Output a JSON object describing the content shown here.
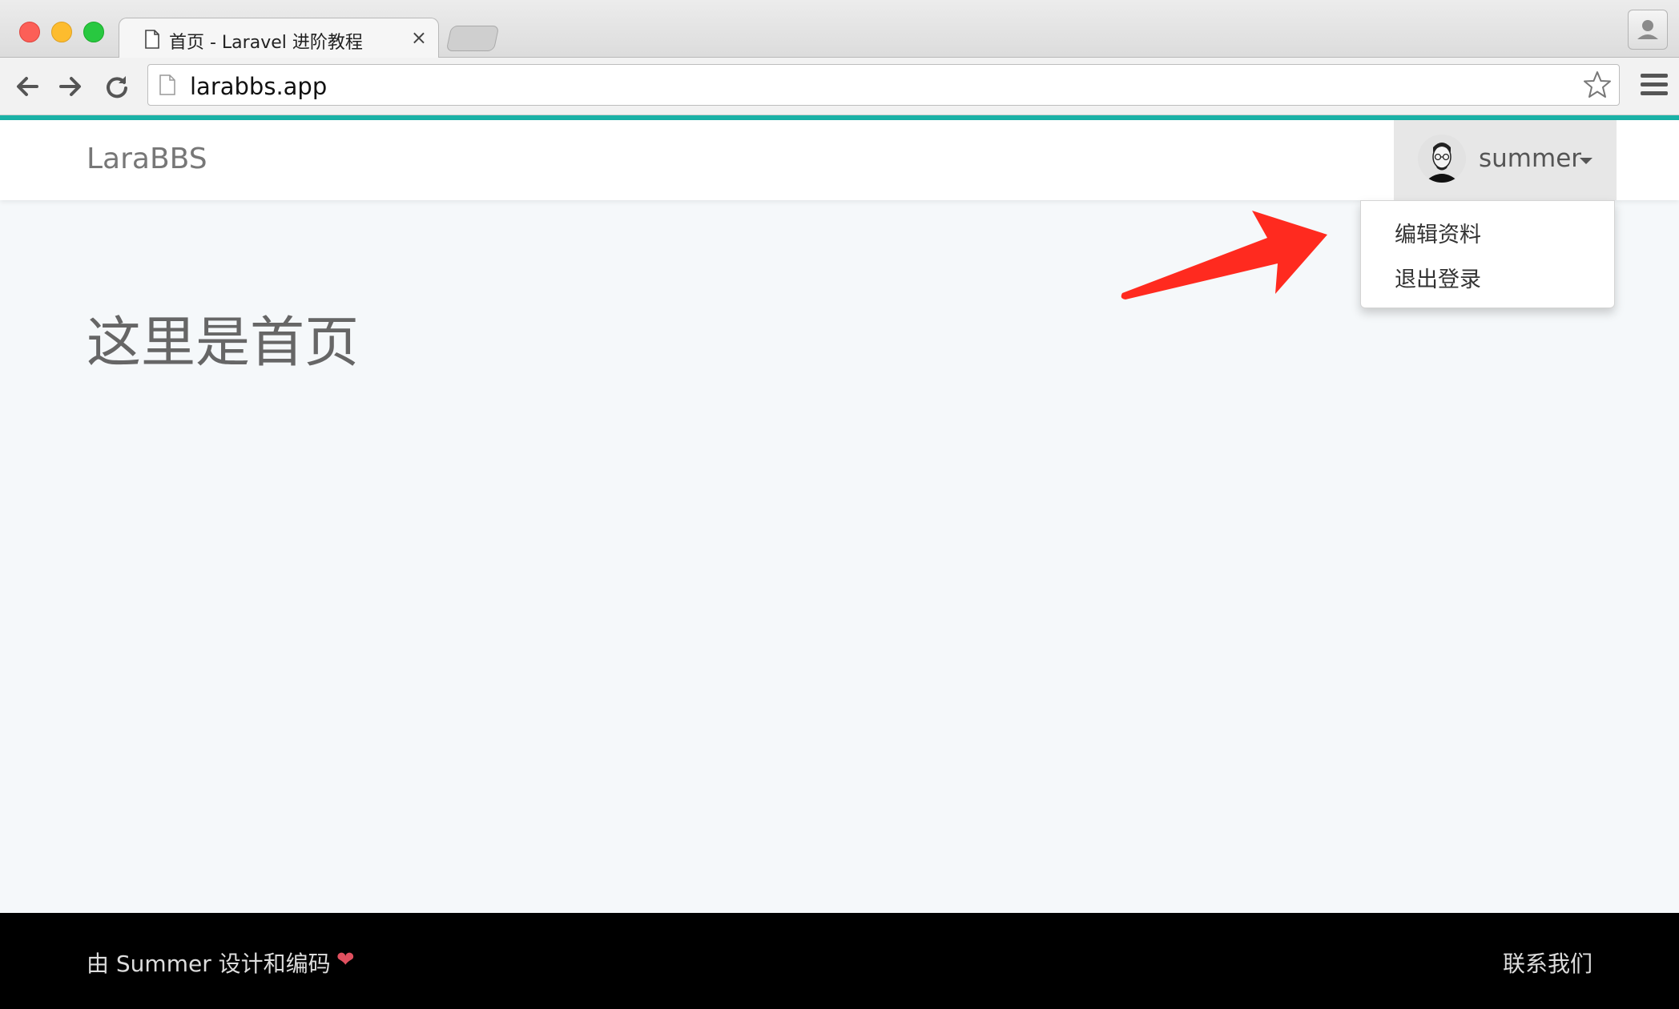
{
  "browser": {
    "tab_title": "首页 - Laravel 进阶教程",
    "tab_close": "×",
    "url": "larabbs.app",
    "icons": {
      "back": "back-arrow-icon",
      "forward": "forward-arrow-icon",
      "reload": "reload-icon",
      "page": "document-icon",
      "bookmark": "star-icon",
      "menu": "hamburger-menu-icon",
      "profile": "user-profile-icon"
    }
  },
  "navbar": {
    "brand": "LaraBBS",
    "user": {
      "name": "summer",
      "avatar": "avatar-image"
    }
  },
  "dropdown": {
    "items": [
      {
        "label": "编辑资料"
      },
      {
        "label": "退出登录"
      }
    ]
  },
  "main": {
    "heading": "这里是首页"
  },
  "footer": {
    "credit": "由 Summer 设计和编码",
    "heart": "❤",
    "contact": "联系我们"
  },
  "colors": {
    "accent": "#1ab2a7",
    "page_bg": "#f5f8fa",
    "arrow": "#ff2a1f",
    "footer_bg": "#000000",
    "heart": "#e0505f"
  }
}
